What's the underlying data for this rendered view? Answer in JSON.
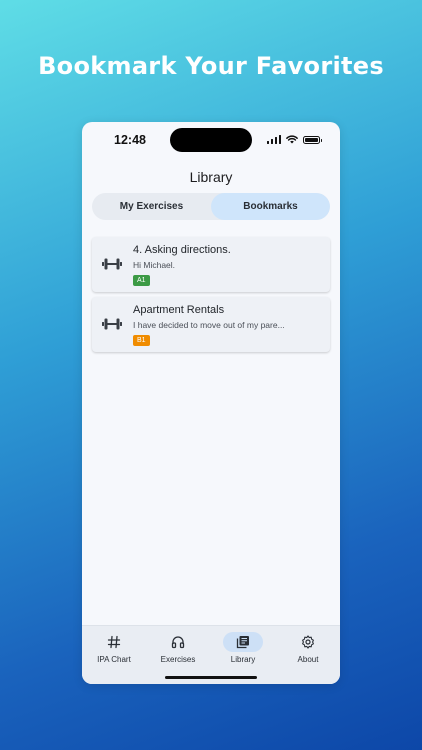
{
  "promo": {
    "headline": "Bookmark Your Favorites"
  },
  "status_bar": {
    "time": "12:48"
  },
  "header": {
    "title": "Library"
  },
  "segments": {
    "my_exercises": "My Exercises",
    "bookmarks": "Bookmarks",
    "selected": "Bookmarks"
  },
  "bookmarks": [
    {
      "title": "4. Asking directions.",
      "subtitle": "Hi Michael.",
      "level": "A1",
      "level_color": "#3c9a45",
      "icon": "dumbbell-icon"
    },
    {
      "title": "Apartment Rentals",
      "subtitle": "I have decided to move out of my pare...",
      "level": "B1",
      "level_color": "#f08c00",
      "icon": "dumbbell-icon"
    }
  ],
  "tab_bar": {
    "ipa_chart": "IPA Chart",
    "exercises": "Exercises",
    "library": "Library",
    "about": "About",
    "active": "Library"
  },
  "colors": {
    "accent": "#cfe5fb",
    "tab_active_pill": "#cde0f6"
  }
}
